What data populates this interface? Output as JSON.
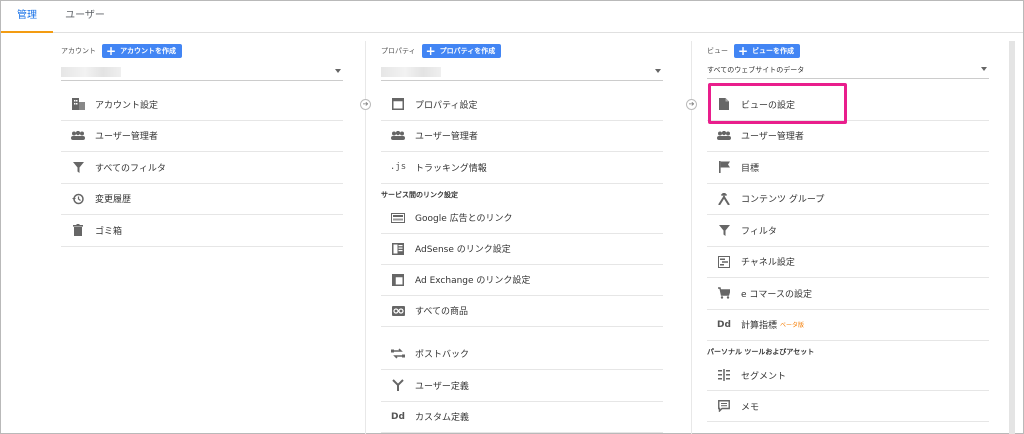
{
  "tabs": {
    "admin": "管理",
    "user": "ユーザー"
  },
  "account": {
    "label": "アカウント",
    "create_label": "アカウントを作成",
    "select_value": "",
    "items": [
      "アカウント設定",
      "ユーザー管理者",
      "すべてのフィルタ",
      "変更履歴",
      "ゴミ箱"
    ]
  },
  "property": {
    "label": "プロパティ",
    "create_label": "プロパティを作成",
    "select_value": "",
    "items": [
      "プロパティ設定",
      "ユーザー管理者",
      "トラッキング情報"
    ],
    "section_links": "サービス間のリンク設定",
    "link_items": [
      "Google 広告とのリンク",
      "AdSense のリンク設定",
      "Ad Exchange のリンク設定",
      "すべての商品"
    ],
    "more_items": [
      "ポストバック",
      "ユーザー定義",
      "カスタム定義"
    ]
  },
  "view": {
    "label": "ビュー",
    "create_label": "ビューを作成",
    "select_value": "すべてのウェブサイトのデータ",
    "items": [
      "ビューの設定",
      "ユーザー管理者",
      "目標",
      "コンテンツ グループ",
      "フィルタ",
      "チャネル設定",
      "e コマースの設定",
      "計算指標"
    ],
    "beta": "ベータ版",
    "section_personal": "パーソナル ツールおよびアセット",
    "personal_items": [
      "セグメント",
      "メモ"
    ]
  },
  "icons": {
    "js_text": ".js",
    "dd_text": "Dd"
  },
  "colors": {
    "accent": "#4285f4",
    "tab_underline": "#f39c12",
    "highlight": "#e91e8c",
    "beta": "#f57c00"
  }
}
